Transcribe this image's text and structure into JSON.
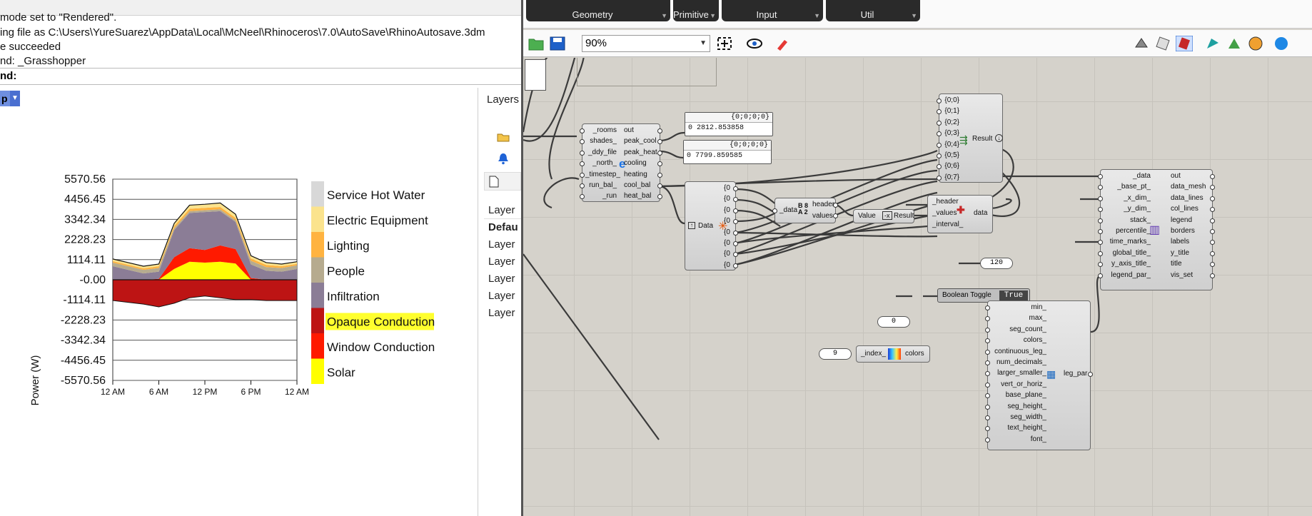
{
  "rhino": {
    "history": [
      "mode set to \"Rendered\".",
      "ing file as C:\\Users\\YureSuarez\\AppData\\Local\\McNeel\\Rhinoceros\\7.0\\AutoSave\\RhinoAutosave.3dm",
      "e succeeded",
      "nd: _Grasshopper"
    ],
    "prompt": "nd:",
    "viewport_tab": "p"
  },
  "chart_data": {
    "type": "area",
    "stacked": true,
    "ylabel": "Power (W)",
    "y_ticks": [
      "5570.56",
      "4456.45",
      "3342.34",
      "2228.23",
      "1114.11",
      "-0.00",
      "-1114.11",
      "-2228.23",
      "-3342.34",
      "-4456.45",
      "-5570.56"
    ],
    "ylim": [
      -5570.56,
      5570.56
    ],
    "x_ticks": [
      "12 AM",
      "6 AM",
      "12 PM",
      "6 PM",
      "12 AM"
    ],
    "x": [
      0,
      2,
      4,
      6,
      8,
      10,
      12,
      14,
      16,
      18,
      20,
      22,
      24
    ],
    "series": [
      {
        "name": "Solar",
        "color": "#ffff00",
        "values": [
          0,
          0,
          0,
          0,
          600,
          1000,
          950,
          1000,
          900,
          0,
          0,
          0,
          0
        ]
      },
      {
        "name": "Window Conduction",
        "color": "#ff1a00",
        "values": [
          0,
          0,
          0,
          50,
          650,
          750,
          700,
          900,
          800,
          100,
          0,
          0,
          0
        ]
      },
      {
        "name": "Infiltration",
        "color": "#8b7d96",
        "values": [
          750,
          550,
          350,
          400,
          1500,
          1950,
          2100,
          1900,
          1500,
          750,
          500,
          450,
          600
        ]
      },
      {
        "name": "People",
        "color": "#b6ab8f",
        "values": [
          200,
          200,
          200,
          200,
          100,
          100,
          100,
          100,
          100,
          200,
          200,
          200,
          200
        ]
      },
      {
        "name": "Lighting",
        "color": "#ffb340",
        "values": [
          80,
          80,
          80,
          100,
          120,
          130,
          130,
          130,
          130,
          130,
          120,
          100,
          80
        ]
      },
      {
        "name": "Electric Equipment",
        "color": "#fbe38d",
        "values": [
          120,
          120,
          120,
          120,
          150,
          200,
          200,
          220,
          200,
          150,
          130,
          120,
          120
        ]
      },
      {
        "name": "Service Hot Water",
        "color": "#d8d8d8",
        "values": [
          0,
          0,
          0,
          0,
          0,
          0,
          0,
          0,
          0,
          0,
          0,
          0,
          0
        ]
      },
      {
        "name": "Opaque Conduction",
        "color": "#bd1414",
        "values": [
          -1150,
          -1250,
          -1350,
          -1500,
          -1300,
          -1000,
          -900,
          -1000,
          -1100,
          -1100,
          -1150,
          -1150,
          -1150
        ]
      }
    ],
    "legend": [
      {
        "label": "Service Hot Water",
        "color": "#d8d8d8"
      },
      {
        "label": "Electric Equipment",
        "color": "#fbe38d"
      },
      {
        "label": "Lighting",
        "color": "#ffb340"
      },
      {
        "label": "People",
        "color": "#b6ab8f"
      },
      {
        "label": "Infiltration",
        "color": "#8b7d96"
      },
      {
        "label": "Opaque Conduction",
        "color": "#bd1414",
        "highlighted": true
      },
      {
        "label": "Window Conduction",
        "color": "#ff1a00"
      },
      {
        "label": "Solar",
        "color": "#ffff00"
      }
    ],
    "legend_placement": "right",
    "grid": true
  },
  "layers": {
    "title": "Layers",
    "header": "Layer",
    "rows": [
      "Defau",
      "Layer",
      "Layer",
      "Layer",
      "Layer",
      "Layer"
    ]
  },
  "grasshopper": {
    "tab_groups": [
      "Geometry",
      "Primitive",
      "Input",
      "Util"
    ],
    "zoom": "90%",
    "energy_balance": {
      "inputs": [
        "_rooms",
        "shades_",
        "_ddy_file",
        "_north_",
        "_timestep_",
        "run_bal_",
        "_run"
      ],
      "outputs": [
        "out",
        "peak_cool",
        "peak_heat",
        "cooling",
        "heating",
        "cool_bal",
        "heat_bal"
      ]
    },
    "panel_cool": {
      "header": "{0;0;0;0}",
      "index": "0",
      "value": "2812.853858"
    },
    "panel_heat": {
      "header": "{0;0;0;0}",
      "index": "0",
      "value": "7799.859585"
    },
    "data_tree": {
      "label": "Data",
      "outputs": [
        "{0",
        "{0",
        "{0",
        "{0",
        "{0",
        "{0",
        "{0",
        "{0"
      ]
    },
    "entwine": {
      "inputs": [
        "{0;0}",
        "{0;1}",
        "{0;2}",
        "{0;3}",
        "{0;4}",
        "{0;5}",
        "{0;6}",
        "{0;7}"
      ],
      "output": "Result"
    },
    "deconstruct": {
      "input": "_data",
      "outputs": [
        "header",
        "values"
      ]
    },
    "value_comp": {
      "input": "Value",
      "output": "Result"
    },
    "construct": {
      "inputs": [
        "_header",
        "_values",
        "_interval_"
      ],
      "output": "data"
    },
    "stacked_chart": {
      "inputs": [
        "_data",
        "_base_pt_",
        "_x_dim_",
        "_y_dim_",
        "stack_",
        "percentile_",
        "time_marks_",
        "global_title_",
        "y_axis_title_",
        "legend_par_"
      ],
      "outputs": [
        "out",
        "data_mesh",
        "data_lines",
        "col_lines",
        "legend",
        "borders",
        "labels",
        "y_title",
        "title",
        "vis_set"
      ]
    },
    "slider_120": "120",
    "slider_0": "0",
    "slider_9": "9",
    "toggle": {
      "label": "Boolean Toggle",
      "value": "True"
    },
    "gradient": {
      "input": "_index_",
      "output": "colors"
    },
    "legend_par": {
      "inputs": [
        "min_",
        "max_",
        "seg_count_",
        "colors_",
        "continuous_leg_",
        "num_decimals_",
        "larger_smaller_",
        "vert_or_horiz_",
        "base_plane_",
        "seg_height_",
        "seg_width_",
        "text_height_",
        "font_"
      ],
      "output": "leg_par"
    }
  }
}
